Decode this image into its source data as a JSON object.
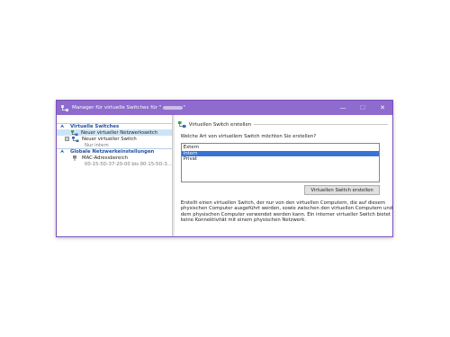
{
  "window": {
    "title": "Manager für virtuelle Switches für \"",
    "title_suffix": "\"",
    "controls": {
      "minimize": "—",
      "maximize": "☐",
      "close": "✕"
    }
  },
  "tree": {
    "section_switches": "Virtuelle Switches",
    "new_switch": "Neuer virtueller Netzwerkswitch",
    "switch_name": "Neuer virtueller Switch",
    "switch_sub": "Nur intern",
    "section_global": "Globale Netzwerkeinstellungen",
    "mac_label": "MAC-Adressbereich",
    "mac_range": "00-15-5D-37-20-00 bis 00-15-5D-3..."
  },
  "detail": {
    "group_title": "Virtuellen Switch erstellen",
    "question": "Welche Art von virtuellem Switch möchten Sie erstellen?",
    "options": [
      "Extern",
      "Intern",
      "Privat"
    ],
    "selected_index": 1,
    "create_button": "Virtuellen Switch erstellen",
    "description_lines": [
      "Erstellt einen virtuellen Switch, der nur von den virtuellen Computern, die auf diesem",
      "physischen Computer ausgeführt werden, sowie zwischen den virtuellen Computern und",
      "dem physischen Computer verwendet werden kann. Ein interner virtueller Switch bietet",
      "keine Konnektivität mit einem physischen Netzwerk."
    ]
  },
  "colors": {
    "titlebar": "#8e6bcd",
    "section_text": "#1f4e9e",
    "selection": "#3874d8"
  }
}
